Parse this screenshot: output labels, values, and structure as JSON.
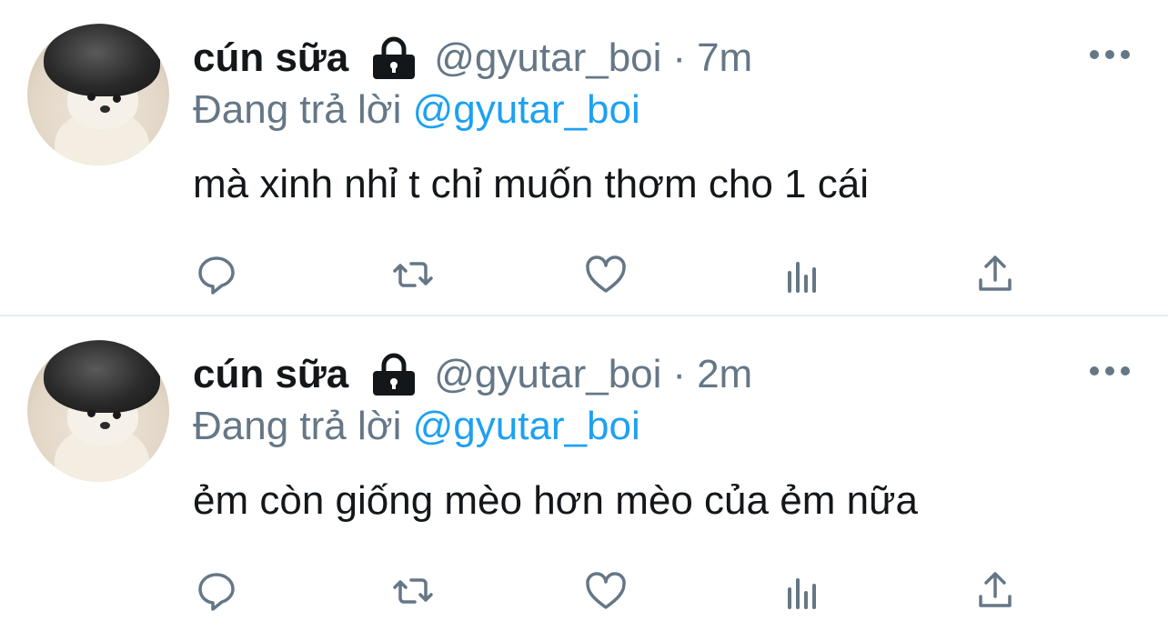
{
  "tweets": [
    {
      "display_name": "cún sữa",
      "handle": "@gyutar_boi",
      "separator": "·",
      "time": "7m",
      "replying_prefix": "Đang trả lời",
      "replying_to": "@gyutar_boi",
      "text": "mà xinh nhỉ t chỉ muốn thơm cho 1 cái"
    },
    {
      "display_name": "cún sữa",
      "handle": "@gyutar_boi",
      "separator": "·",
      "time": "2m",
      "replying_prefix": "Đang trả lời",
      "replying_to": "@gyutar_boi",
      "text": "ẻm còn giống mèo hơn mèo của ẻm nữa"
    }
  ],
  "icons": {
    "lock": "lock-icon",
    "more": "more-icon",
    "reply": "reply-icon",
    "retweet": "retweet-icon",
    "like": "heart-icon",
    "stats": "stats-icon",
    "share": "share-icon"
  },
  "colors": {
    "text": "#14171a",
    "secondary": "#657786",
    "accent": "#1da1f2",
    "divider": "#e6ecf0"
  }
}
